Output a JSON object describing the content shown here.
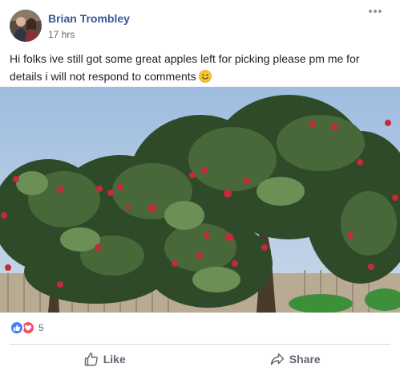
{
  "post": {
    "author": "Brian Trombley",
    "timestamp": "17 hrs",
    "text": "Hi folks ive still got some great apples left for picking please pm me for details i will not respond to comments",
    "emoji": "smiley-emoji"
  },
  "reactions": {
    "icons": [
      "like-reaction-icon",
      "love-reaction-icon"
    ],
    "count": "5"
  },
  "actions": {
    "like_label": "Like",
    "share_label": "Share"
  },
  "colors": {
    "author_link": "#365899",
    "like_blue": "#4080ff",
    "love_red": "#f25268",
    "muted_text": "#606770"
  }
}
